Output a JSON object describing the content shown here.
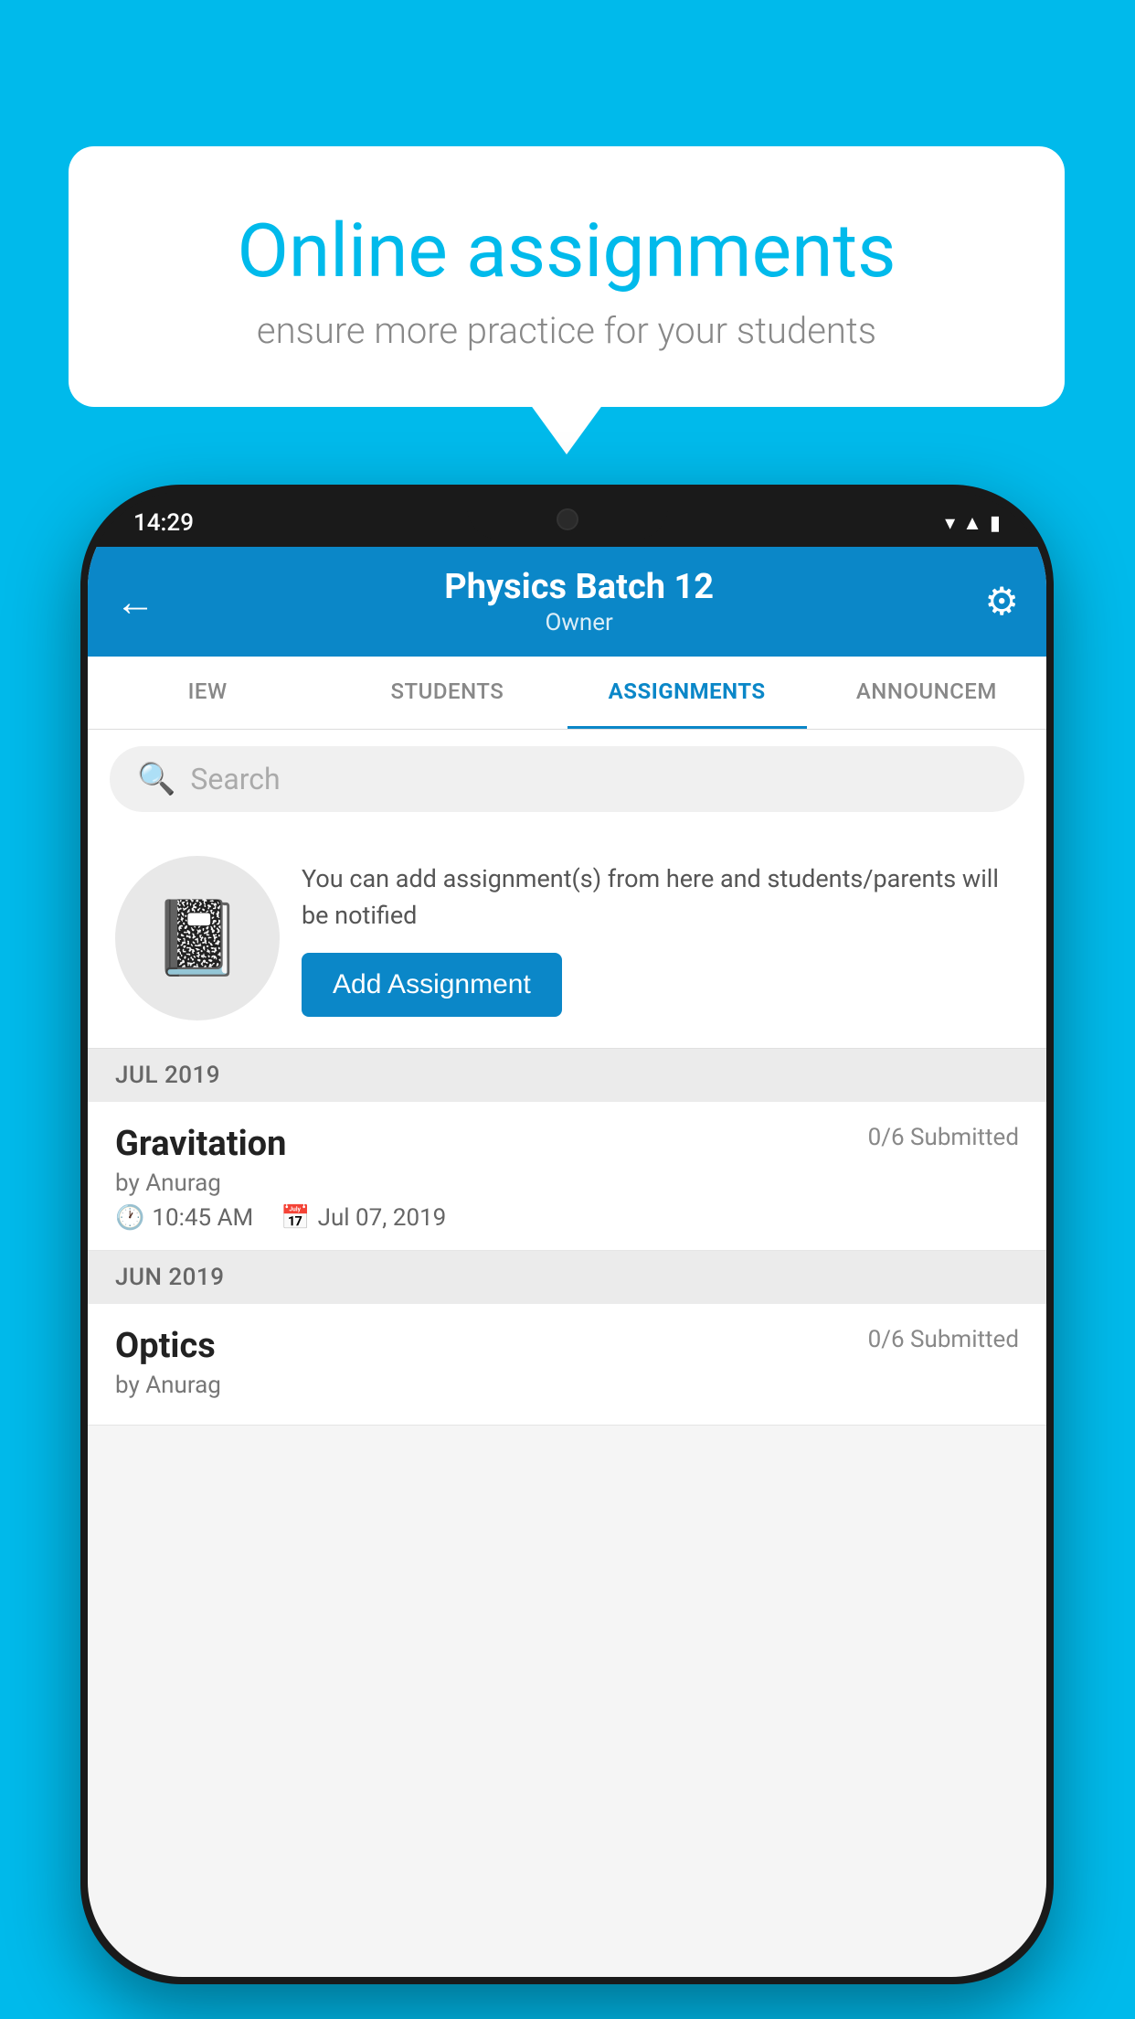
{
  "background_color": "#00BAEB",
  "speech_bubble": {
    "title": "Online assignments",
    "subtitle": "ensure more practice for your students"
  },
  "status_bar": {
    "time": "14:29",
    "icons": [
      "wifi",
      "signal",
      "battery"
    ]
  },
  "app_bar": {
    "title": "Physics Batch 12",
    "subtitle": "Owner",
    "back_label": "←",
    "settings_label": "⚙"
  },
  "tabs": [
    {
      "label": "IEW",
      "active": false
    },
    {
      "label": "STUDENTS",
      "active": false
    },
    {
      "label": "ASSIGNMENTS",
      "active": true
    },
    {
      "label": "ANNOUNCEM",
      "active": false
    }
  ],
  "search": {
    "placeholder": "Search"
  },
  "promo_card": {
    "description": "You can add assignment(s) from here and students/parents will be notified",
    "button_label": "Add Assignment"
  },
  "sections": [
    {
      "header": "JUL 2019",
      "assignments": [
        {
          "name": "Gravitation",
          "submitted": "0/6 Submitted",
          "by": "by Anurag",
          "time": "10:45 AM",
          "date": "Jul 07, 2019"
        }
      ]
    },
    {
      "header": "JUN 2019",
      "assignments": [
        {
          "name": "Optics",
          "submitted": "0/6 Submitted",
          "by": "by Anurag",
          "time": "",
          "date": ""
        }
      ]
    }
  ]
}
